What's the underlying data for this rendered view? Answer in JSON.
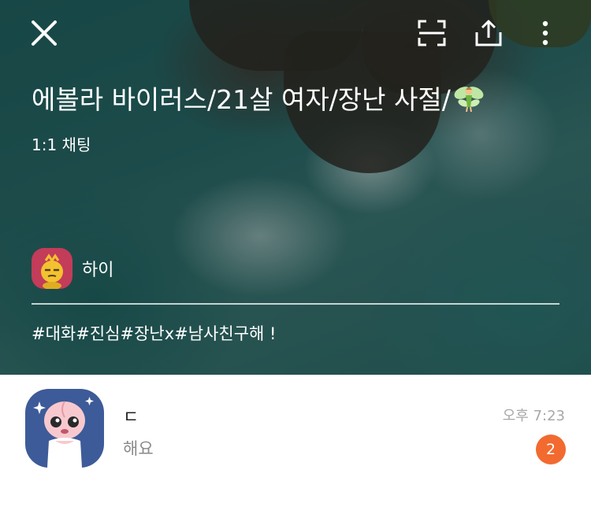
{
  "header": {
    "room_title": "에볼라 바이러스/21살 여자/장난 사절/",
    "room_type": "1:1 채팅",
    "host_name": "하이",
    "hashtags": "#대화#진심#장난x#남사친구해 !",
    "icons": [
      "close-icon",
      "capture-icon",
      "share-icon",
      "more-icon",
      "fairy-emoji"
    ]
  },
  "chat": {
    "sender": "ㄷ",
    "preview": "해요",
    "time": "오후 7:23",
    "unread_count": "2"
  },
  "colors": {
    "badge": "#f26a2f",
    "host_avatar_bg": "#c33c59",
    "chat_avatar_bg": "#3d5b98"
  }
}
